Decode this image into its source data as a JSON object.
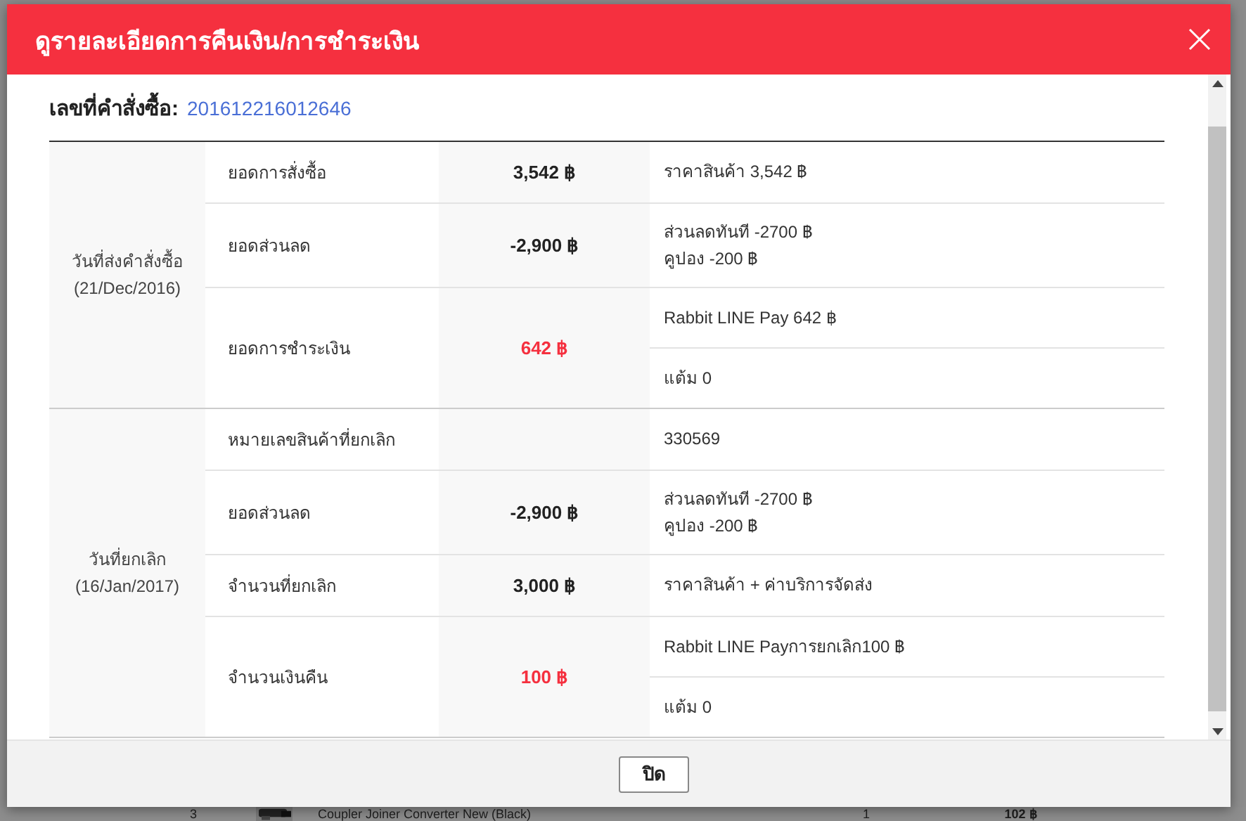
{
  "dialog": {
    "title": "ดูรายละเอียดการคืนเงิน/การชำระเงิน",
    "order": {
      "label": "เลขที่คำสั่งซื้อ:",
      "number": "201612216012646"
    },
    "sections": [
      {
        "date_label": "วันที่ส่งคำสั่งซื้อ",
        "date": "(21/Dec/2016)",
        "rows": [
          {
            "label": "ยอดการสั่งซื้อ",
            "value": "3,542 ฿",
            "highlight": false,
            "details": [
              [
                "ราคาสินค้า 3,542 ฿"
              ]
            ]
          },
          {
            "label": "ยอดส่วนลด",
            "value": "-2,900 ฿",
            "highlight": false,
            "details": [
              [
                "ส่วนลดทันที -2700 ฿",
                "คูปอง -200 ฿"
              ]
            ]
          },
          {
            "label": "ยอดการชำระเงิน",
            "value": "642 ฿",
            "highlight": true,
            "details": [
              [
                "Rabbit LINE Pay 642 ฿"
              ],
              [
                "แต้ม 0"
              ]
            ]
          }
        ]
      },
      {
        "date_label": "วันที่ยกเลิก",
        "date": "(16/Jan/2017)",
        "rows": [
          {
            "label": "หมายเลขสินค้าที่ยกเลิก",
            "details": [
              [
                "330569"
              ]
            ]
          },
          {
            "label": "ยอดส่วนลด",
            "value": "-2,900 ฿",
            "highlight": false,
            "details": [
              [
                "ส่วนลดทันที -2700 ฿",
                "คูปอง -200 ฿"
              ]
            ]
          },
          {
            "label": "จำนวนที่ยกเลิก",
            "value": "3,000 ฿",
            "highlight": false,
            "details": [
              [
                "ราคาสินค้า + ค่าบริการจัดส่ง"
              ]
            ]
          },
          {
            "label": "จำนวนเงินคืน",
            "value": "100 ฿",
            "highlight": true,
            "details": [
              [
                "Rabbit LINE Payการยกเลิก100 ฿"
              ],
              [
                "แต้ม 0"
              ]
            ]
          }
        ]
      }
    ],
    "close_button": "ปิด"
  },
  "background_row": {
    "index": "3",
    "product": "Coupler Joiner Converter New (Black)",
    "quantity": "1",
    "price": "102 ฿"
  }
}
